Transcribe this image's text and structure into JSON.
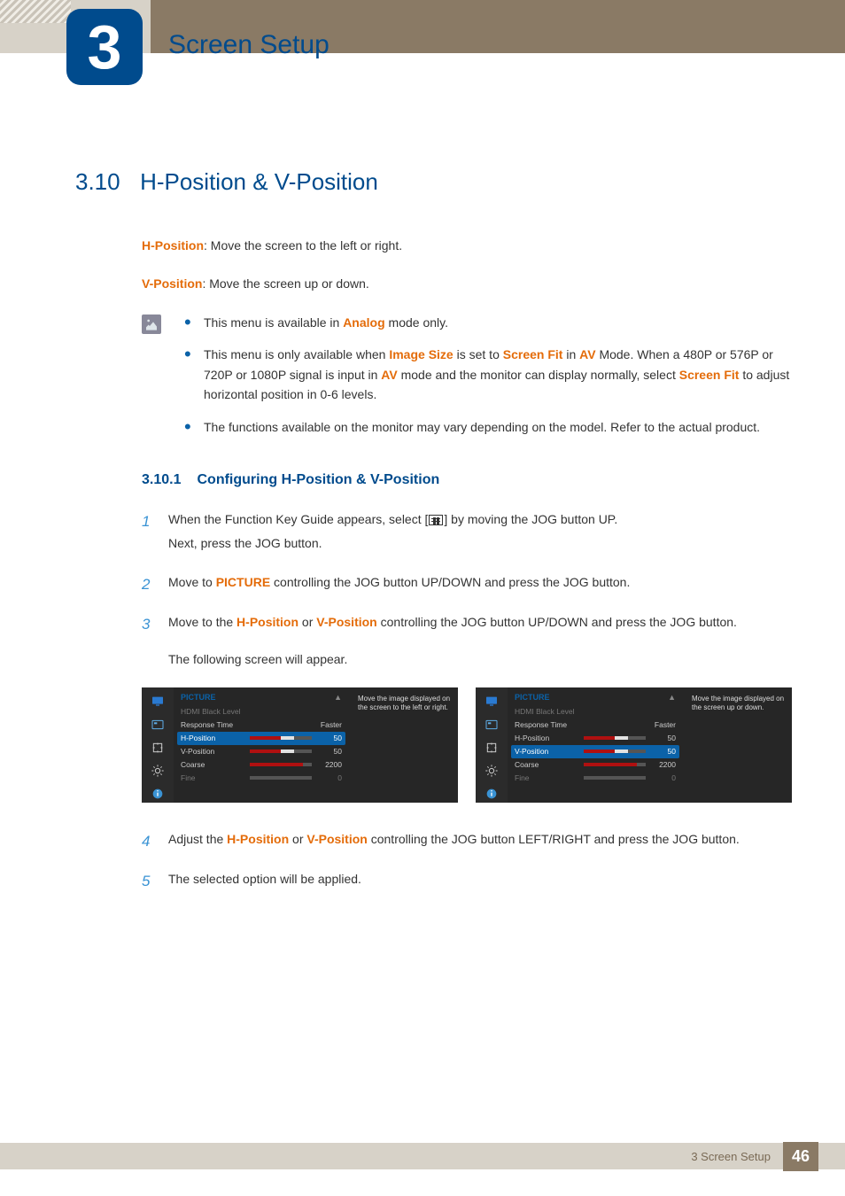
{
  "header": {
    "chapter_number": "3",
    "chapter_title": "Screen Setup"
  },
  "section": {
    "number": "3.10",
    "title": "H-Position & V-Position"
  },
  "intro": {
    "hpos_label": "H-Position",
    "hpos_text": ": Move the screen to the left or right.",
    "vpos_label": "V-Position",
    "vpos_text": ": Move the screen up or down."
  },
  "notes": {
    "n1_a": "This menu is available in ",
    "n1_hl": "Analog",
    "n1_b": " mode only.",
    "n2_a": "This menu is only available when ",
    "n2_hl1": "Image Size",
    "n2_b": " is set to ",
    "n2_hl2": "Screen Fit",
    "n2_c": " in ",
    "n2_hl3": "AV",
    "n2_d": " Mode. When a 480P or 576P or 720P or 1080P signal is input in ",
    "n2_hl4": "AV",
    "n2_e": " mode and the monitor can display normally, select ",
    "n2_hl5": "Screen Fit",
    "n2_f": " to adjust horizontal position in 0-6 levels.",
    "n3": "The functions available on the monitor may vary depending on the model. Refer to the actual product."
  },
  "subsection": {
    "number": "3.10.1",
    "title": "Configuring H-Position & V-Position"
  },
  "steps": {
    "s1n": "1",
    "s1a": "When the Function Key Guide appears, select [",
    "s1b": "] by moving the JOG button UP.",
    "s1c": "Next, press the JOG button.",
    "s2n": "2",
    "s2a": "Move to ",
    "s2hl": "PICTURE",
    "s2b": " controlling the JOG button UP/DOWN and press the JOG button.",
    "s3n": "3",
    "s3a": "Move to the ",
    "s3hl1": "H-Position",
    "s3b": " or ",
    "s3hl2": "V-Position",
    "s3c": " controlling the JOG button UP/DOWN and press the JOG button.",
    "s3d": "The following screen will appear.",
    "s4n": "4",
    "s4a": "Adjust the ",
    "s4hl1": "H-Position",
    "s4b": " or ",
    "s4hl2": "V-Position",
    "s4c": " controlling the JOG button LEFT/RIGHT and press the JOG button.",
    "s5n": "5",
    "s5a": "The selected option will be applied."
  },
  "osd": {
    "title": "PICTURE",
    "arrow": "▲",
    "hdmi": "HDMI Black Level",
    "response": "Response Time",
    "response_val": "Faster",
    "hpos": "H-Position",
    "hpos_val": "50",
    "vpos": "V-Position",
    "vpos_val": "50",
    "coarse": "Coarse",
    "coarse_val": "2200",
    "fine": "Fine",
    "fine_val": "0",
    "desc_h": "Move the image displayed on the screen to the left or right.",
    "desc_v": "Move the image displayed on the screen up or down."
  },
  "footer": {
    "text": "3 Screen Setup",
    "page": "46"
  }
}
